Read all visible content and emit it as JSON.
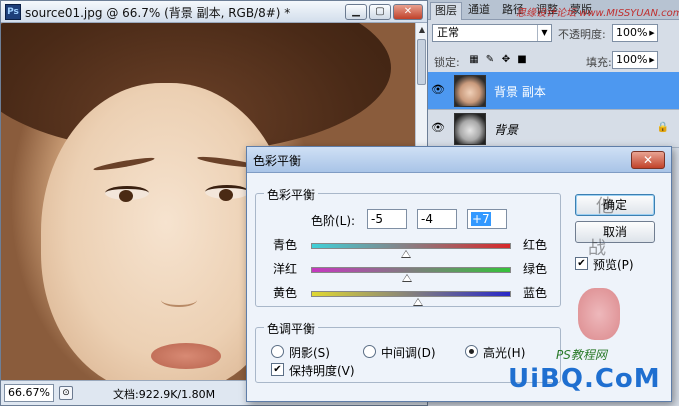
{
  "document": {
    "title": "source01.jpg @ 66.7% (背景 副本, RGB/8#) *",
    "min_glyph": "▁",
    "restore_glyph": "▢",
    "close_glyph": "✕",
    "zoom": "66.67%",
    "doc_size": "文档:922.9K/1.80M"
  },
  "panel": {
    "tabs": [
      "图层",
      "通道",
      "路径",
      "调整",
      "蒙版"
    ],
    "watermark_text": "思缘设计论坛 www.MISSYUAN.com",
    "blend_mode": "正常",
    "opacity_label": "不透明度:",
    "opacity": "100%",
    "lock_label": "锁定:",
    "fill_label": "填充:",
    "fill": "100%",
    "layers": [
      {
        "name": "背景 副本",
        "selected": true,
        "locked": false
      },
      {
        "name": "背景",
        "selected": false,
        "locked": true
      }
    ]
  },
  "dialog": {
    "title": "色彩平衡",
    "close_glyph": "✕",
    "balance_group": "色彩平衡",
    "levels_label": "色阶(L):",
    "levels": [
      "-5",
      "-4",
      "+7"
    ],
    "sliders": [
      {
        "left": "青色",
        "right": "红色",
        "value": -5,
        "gradient": [
          "#3fd0d8",
          "#d8282a"
        ]
      },
      {
        "left": "洋红",
        "right": "绿色",
        "value": -4,
        "gradient": [
          "#c638c0",
          "#36c23a"
        ]
      },
      {
        "left": "黄色",
        "right": "蓝色",
        "value": 7,
        "gradient": [
          "#e0d832",
          "#2828c8"
        ]
      }
    ],
    "tone_group": "色调平衡",
    "tones": [
      {
        "label": "阴影(S)",
        "checked": false
      },
      {
        "label": "中间调(D)",
        "checked": false
      },
      {
        "label": "高光(H)",
        "checked": true
      }
    ],
    "preserve_label": "保持明度(V)",
    "preserve_checked": true,
    "ok": "确定",
    "cancel": "取消",
    "preview": "预览(P)",
    "preview_checked": true
  },
  "watermarks": {
    "site": "PS教程网",
    "brand": "UiBQ.CoM"
  }
}
